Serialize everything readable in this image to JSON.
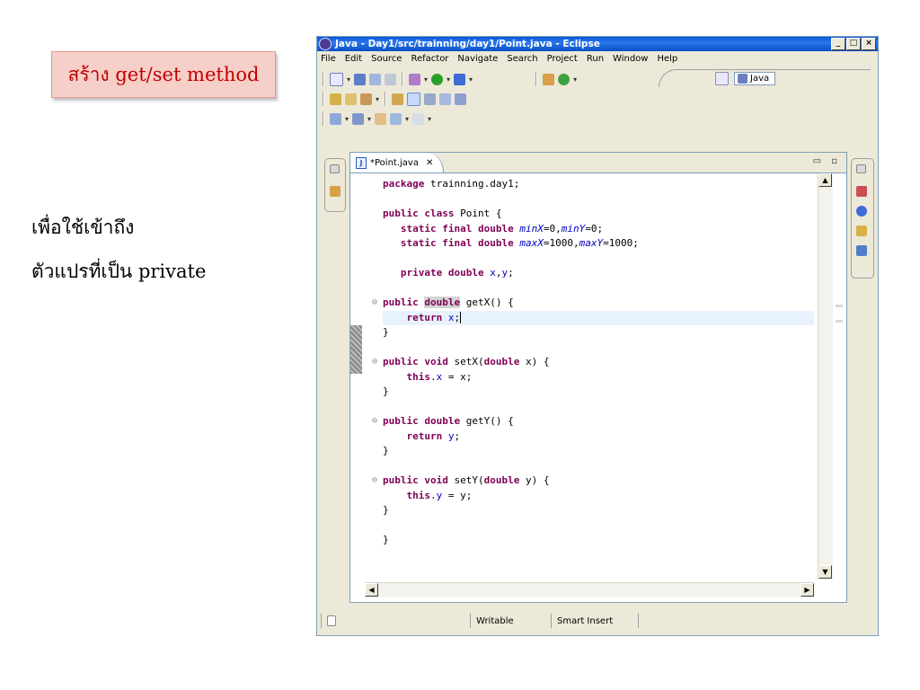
{
  "slide": {
    "title": "สร้าง  get/set method",
    "note_line1": "เพื่อใช้เข้าถึง",
    "note_line2": "ตัวแปรที่เป็น  private"
  },
  "window": {
    "title": "Java - Day1/src/trainning/day1/Point.java - Eclipse",
    "buttons": {
      "minimize": "_",
      "maximize": "□",
      "close": "×"
    }
  },
  "menu": [
    "File",
    "Edit",
    "Source",
    "Refactor",
    "Navigate",
    "Search",
    "Project",
    "Run",
    "Window",
    "Help"
  ],
  "perspective": {
    "label": "Java"
  },
  "editor": {
    "tab_label": "*Point.java",
    "tab_close": "✕",
    "code_lines": [
      {
        "tokens": [
          [
            "kw",
            "package"
          ],
          [
            "txt",
            " trainning.day1;"
          ]
        ]
      },
      {
        "tokens": []
      },
      {
        "tokens": [
          [
            "kw",
            "public"
          ],
          [
            "txt",
            " "
          ],
          [
            "kw",
            "class"
          ],
          [
            "txt",
            " Point {"
          ]
        ]
      },
      {
        "tokens": [
          [
            "txt",
            "   "
          ],
          [
            "kw",
            "static"
          ],
          [
            "txt",
            " "
          ],
          [
            "kw",
            "final"
          ],
          [
            "txt",
            " "
          ],
          [
            "kw",
            "double"
          ],
          [
            "txt",
            " "
          ],
          [
            "sfield",
            "minX"
          ],
          [
            "txt",
            "=0,"
          ],
          [
            "sfield",
            "minY"
          ],
          [
            "txt",
            "=0;"
          ]
        ]
      },
      {
        "tokens": [
          [
            "txt",
            "   "
          ],
          [
            "kw",
            "static"
          ],
          [
            "txt",
            " "
          ],
          [
            "kw",
            "final"
          ],
          [
            "txt",
            " "
          ],
          [
            "kw",
            "double"
          ],
          [
            "txt",
            " "
          ],
          [
            "sfield",
            "maxX"
          ],
          [
            "txt",
            "=1000,"
          ],
          [
            "sfield",
            "maxY"
          ],
          [
            "txt",
            "=1000;"
          ]
        ]
      },
      {
        "tokens": []
      },
      {
        "tokens": [
          [
            "txt",
            "   "
          ],
          [
            "kw",
            "private"
          ],
          [
            "txt",
            " "
          ],
          [
            "kw",
            "double"
          ],
          [
            "txt",
            " "
          ],
          [
            "field",
            "x"
          ],
          [
            "txt",
            ","
          ],
          [
            "field",
            "y"
          ],
          [
            "txt",
            ";"
          ]
        ]
      },
      {
        "tokens": []
      },
      {
        "fold": true,
        "tokens": [
          [
            "kw",
            "public"
          ],
          [
            "txt",
            " "
          ],
          [
            "kwsel",
            "double"
          ],
          [
            "txt",
            " getX() {"
          ]
        ]
      },
      {
        "current": true,
        "tokens": [
          [
            "txt",
            "    "
          ],
          [
            "kw",
            "return"
          ],
          [
            "txt",
            " "
          ],
          [
            "field",
            "x"
          ],
          [
            "txt",
            ";"
          ]
        ]
      },
      {
        "tokens": [
          [
            "txt",
            "}"
          ]
        ]
      },
      {
        "tokens": []
      },
      {
        "fold": true,
        "tokens": [
          [
            "kw",
            "public"
          ],
          [
            "txt",
            " "
          ],
          [
            "kw",
            "void"
          ],
          [
            "txt",
            " setX("
          ],
          [
            "kw",
            "double"
          ],
          [
            "txt",
            " x) {"
          ]
        ]
      },
      {
        "tokens": [
          [
            "txt",
            "    "
          ],
          [
            "kw",
            "this"
          ],
          [
            "txt",
            "."
          ],
          [
            "field",
            "x"
          ],
          [
            "txt",
            " = x;"
          ]
        ]
      },
      {
        "tokens": [
          [
            "txt",
            "}"
          ]
        ]
      },
      {
        "tokens": []
      },
      {
        "fold": true,
        "tokens": [
          [
            "kw",
            "public"
          ],
          [
            "txt",
            " "
          ],
          [
            "kw",
            "double"
          ],
          [
            "txt",
            " getY() {"
          ]
        ]
      },
      {
        "tokens": [
          [
            "txt",
            "    "
          ],
          [
            "kw",
            "return"
          ],
          [
            "txt",
            " "
          ],
          [
            "field",
            "y"
          ],
          [
            "txt",
            ";"
          ]
        ]
      },
      {
        "tokens": [
          [
            "txt",
            "}"
          ]
        ]
      },
      {
        "tokens": []
      },
      {
        "fold": true,
        "tokens": [
          [
            "kw",
            "public"
          ],
          [
            "txt",
            " "
          ],
          [
            "kw",
            "void"
          ],
          [
            "txt",
            " setY("
          ],
          [
            "kw",
            "double"
          ],
          [
            "txt",
            " y) {"
          ]
        ]
      },
      {
        "tokens": [
          [
            "txt",
            "    "
          ],
          [
            "kw",
            "this"
          ],
          [
            "txt",
            "."
          ],
          [
            "field",
            "y"
          ],
          [
            "txt",
            " = y;"
          ]
        ]
      },
      {
        "tokens": [
          [
            "txt",
            "}"
          ]
        ]
      },
      {
        "tokens": []
      },
      {
        "tokens": [
          [
            "txt",
            "}"
          ]
        ]
      }
    ]
  },
  "status": {
    "writable": "Writable",
    "insert_mode": "Smart Insert"
  },
  "colors": {
    "keyword": "#7f0055",
    "field": "#0000c0",
    "titlebar": "#0a4fc4"
  }
}
